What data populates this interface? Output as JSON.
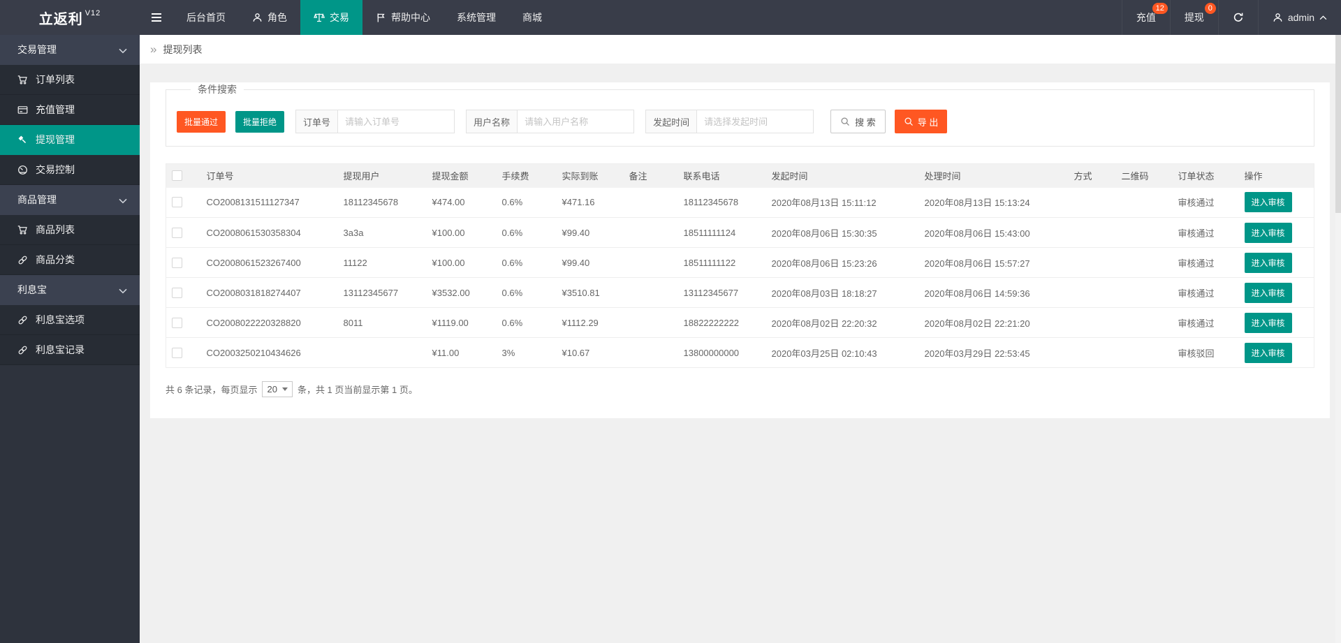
{
  "brand": {
    "name": "立返利",
    "version": "V12"
  },
  "topnav": {
    "items": [
      {
        "label": "后台首页"
      },
      {
        "label": "角色"
      },
      {
        "label": "交易"
      },
      {
        "label": "帮助中心"
      },
      {
        "label": "系统管理"
      },
      {
        "label": "商城"
      }
    ],
    "recharge": {
      "label": "充值",
      "badge": "12"
    },
    "withdraw": {
      "label": "提现",
      "badge": "0"
    },
    "user": {
      "name": "admin"
    }
  },
  "sidebar": {
    "groups": [
      {
        "label": "交易管理",
        "items": [
          {
            "label": "订单列表"
          },
          {
            "label": "充值管理"
          },
          {
            "label": "提现管理"
          },
          {
            "label": "交易控制"
          }
        ]
      },
      {
        "label": "商品管理",
        "items": [
          {
            "label": "商品列表"
          },
          {
            "label": "商品分类"
          }
        ]
      },
      {
        "label": "利息宝",
        "items": [
          {
            "label": "利息宝选项"
          },
          {
            "label": "利息宝记录"
          }
        ]
      }
    ]
  },
  "breadcrumb": {
    "title": "提现列表"
  },
  "filter": {
    "legend": "条件搜索",
    "batch_approve": "批量通过",
    "batch_reject": "批量拒绝",
    "fields": [
      {
        "label": "订单号",
        "placeholder": "请输入订单号"
      },
      {
        "label": "用户名称",
        "placeholder": "请输入用户名称"
      },
      {
        "label": "发起时间",
        "placeholder": "请选择发起时间"
      }
    ],
    "search": "搜 索",
    "export": "导 出"
  },
  "table": {
    "columns": [
      "订单号",
      "提现用户",
      "提现金额",
      "手续费",
      "实际到账",
      "备注",
      "联系电话",
      "发起时间",
      "处理时间",
      "方式",
      "二维码",
      "订单状态",
      "操作"
    ],
    "action": "进入审核",
    "rows": [
      {
        "no": "CO2008131511127347",
        "user": "18112345678",
        "amount": "¥474.00",
        "fee": "0.6%",
        "actual": "¥471.16",
        "remark": "",
        "phone": "18112345678",
        "created": "2020年08月13日 15:11:12",
        "processed": "2020年08月13日 15:13:24",
        "method": "",
        "qrcode": "",
        "status": "审核通过"
      },
      {
        "no": "CO2008061530358304",
        "user": "3a3a",
        "amount": "¥100.00",
        "fee": "0.6%",
        "actual": "¥99.40",
        "remark": "",
        "phone": "18511111124",
        "created": "2020年08月06日 15:30:35",
        "processed": "2020年08月06日 15:43:00",
        "method": "",
        "qrcode": "",
        "status": "审核通过"
      },
      {
        "no": "CO2008061523267400",
        "user": "11122",
        "amount": "¥100.00",
        "fee": "0.6%",
        "actual": "¥99.40",
        "remark": "",
        "phone": "18511111122",
        "created": "2020年08月06日 15:23:26",
        "processed": "2020年08月06日 15:57:27",
        "method": "",
        "qrcode": "",
        "status": "审核通过"
      },
      {
        "no": "CO2008031818274407",
        "user": "13112345677",
        "amount": "¥3532.00",
        "fee": "0.6%",
        "actual": "¥3510.81",
        "remark": "",
        "phone": "13112345677",
        "created": "2020年08月03日 18:18:27",
        "processed": "2020年08月06日 14:59:36",
        "method": "",
        "qrcode": "",
        "status": "审核通过"
      },
      {
        "no": "CO2008022220328820",
        "user": "8011",
        "amount": "¥1119.00",
        "fee": "0.6%",
        "actual": "¥1112.29",
        "remark": "",
        "phone": "18822222222",
        "created": "2020年08月02日 22:20:32",
        "processed": "2020年08月02日 22:21:20",
        "method": "",
        "qrcode": "",
        "status": "审核通过"
      },
      {
        "no": "CO2003250210434626",
        "user": "",
        "amount": "¥11.00",
        "fee": "3%",
        "actual": "¥10.67",
        "remark": "",
        "phone": "13800000000",
        "created": "2020年03月25日 02:10:43",
        "processed": "2020年03月29日 22:53:45",
        "method": "",
        "qrcode": "",
        "status": "审核驳回"
      }
    ]
  },
  "pagination": {
    "prefix": "共 6 条记录，每页显示",
    "page_size": "20",
    "suffix": "条，共 1 页当前显示第 1 页。"
  },
  "colors": {
    "teal": "#009688",
    "orange": "#FF5722"
  }
}
